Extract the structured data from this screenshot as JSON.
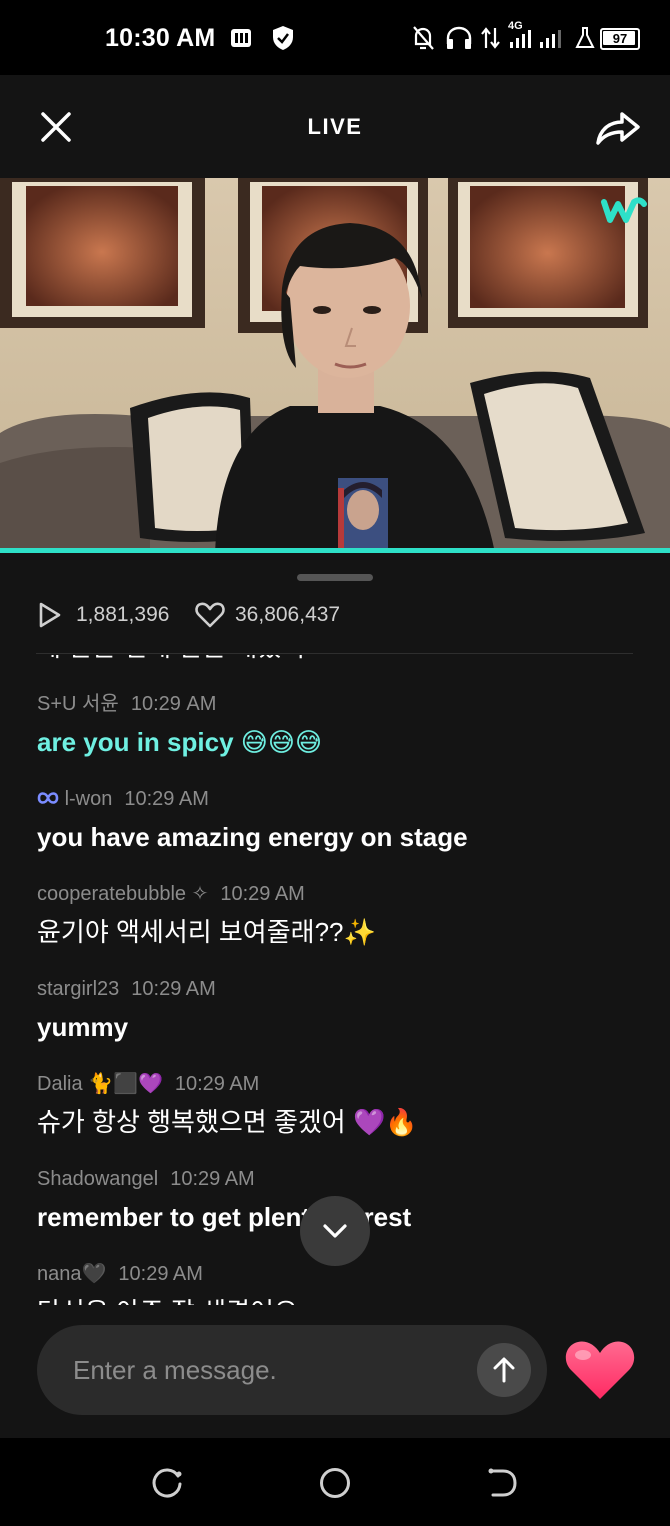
{
  "status_bar": {
    "time": "10:30 AM",
    "network": "4G",
    "battery": "97"
  },
  "header": {
    "title": "LIVE"
  },
  "stats": {
    "plays": "1,881,396",
    "likes": "36,806,437"
  },
  "chat": {
    "cut_off_top": "에 반은 건네 반은 개었어",
    "messages": [
      {
        "user": "S+U 서윤",
        "time": "10:29 AM",
        "text": "are you in spicy",
        "emoji": "😅😅😅"
      },
      {
        "user": "l-won",
        "time": "10:29 AM",
        "text": "you have amazing energy on stage",
        "emoji": ""
      },
      {
        "user": "cooperatebubble ✧",
        "time": "10:29 AM",
        "text": "윤기야 액세서리 보여줄래??",
        "emoji": "✨"
      },
      {
        "user": "stargirl23",
        "time": "10:29 AM",
        "text": "yummy",
        "emoji": ""
      },
      {
        "user": "Dalia 🐈⬛💜",
        "time": "10:29 AM",
        "text": "슈가 항상 행복했으면 좋겠어 ",
        "emoji": "💜🔥"
      },
      {
        "user": "Shadowangel",
        "time": "10:29 AM",
        "text": "remember to get plenty of rest",
        "emoji": ""
      },
      {
        "user": "nana🖤",
        "time": "10:29 AM",
        "text": "당신은 아주 잘 생겼어요",
        "emoji": ""
      }
    ]
  },
  "input": {
    "placeholder": "Enter a message."
  },
  "colors": {
    "accent": "#2ee0c8",
    "teal_text": "#6ff0e2",
    "heart": "#ff3f73"
  },
  "icons": {
    "close": "close-icon",
    "share": "share-icon",
    "play": "play-icon",
    "like": "heart-outline-icon",
    "send": "arrow-up-icon",
    "scroll": "chevron-down-icon",
    "reaction": "heart-icon",
    "brand": "weverse-logo"
  }
}
